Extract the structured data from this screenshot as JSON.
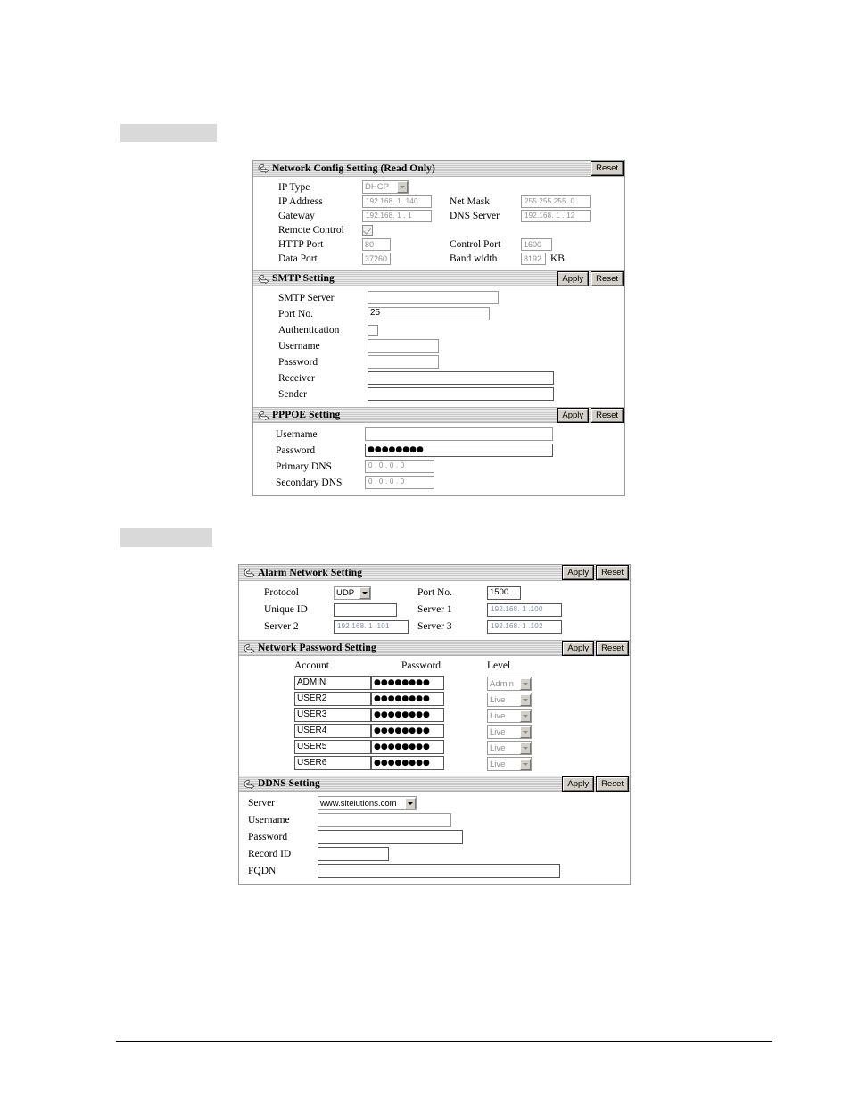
{
  "page": {
    "background": "#ffffff",
    "redacted_heading_1": "",
    "redacted_heading_2": ""
  },
  "common": {
    "apply_label": "Apply",
    "reset_label": "Reset",
    "arrow_icon": "circular-arrow-right-icon"
  },
  "network_config": {
    "title": "Network Config Setting (Read Only)",
    "reset_label": "Reset",
    "fields": {
      "ip_type_label": "IP Type",
      "ip_type_value": "DHCP",
      "ip_address_label": "IP Address",
      "ip_address_value": "192.168.  1 .140",
      "net_mask_label": "Net Mask",
      "net_mask_value": "255.255.255.  0",
      "gateway_label": "Gateway",
      "gateway_value": "192.168.  1 .  1",
      "dns_server_label": "DNS Server",
      "dns_server_value": "192.168.  1 . 12",
      "remote_control_label": "Remote Control",
      "remote_control_checked": true,
      "http_port_label": "HTTP Port",
      "http_port_value": "80",
      "control_port_label": "Control Port",
      "control_port_value": "1600",
      "data_port_label": "Data Port",
      "data_port_value": "37260",
      "band_width_label": "Band width",
      "band_width_value": "8192",
      "band_width_unit": "KB"
    }
  },
  "smtp": {
    "title": "SMTP Setting",
    "apply_label": "Apply",
    "reset_label": "Reset",
    "fields": {
      "server_label": "SMTP Server",
      "server_value": "",
      "port_label": "Port No.",
      "port_value": "25",
      "auth_label": "Authentication",
      "auth_checked": false,
      "username_label": "Username",
      "username_value": "",
      "password_label": "Password",
      "password_value": "",
      "receiver_label": "Receiver",
      "receiver_value": "",
      "sender_label": "Sender",
      "sender_value": ""
    }
  },
  "pppoe": {
    "title": "PPPOE Setting",
    "apply_label": "Apply",
    "reset_label": "Reset",
    "fields": {
      "username_label": "Username",
      "username_value": "",
      "password_label": "Password",
      "password_value": "●●●●●●●●",
      "primary_dns_label": "Primary DNS",
      "primary_dns_value": "0  .  0  .  0  .  0",
      "secondary_dns_label": "Secondary DNS",
      "secondary_dns_value": "0  .  0  .  0  .  0"
    }
  },
  "alarm_network": {
    "title": "Alarm Network Setting",
    "apply_label": "Apply",
    "reset_label": "Reset",
    "fields": {
      "protocol_label": "Protocol",
      "protocol_value": "UDP",
      "port_label": "Port No.",
      "port_value": "1500",
      "unique_id_label": "Unique ID",
      "unique_id_value": "",
      "server1_label": "Server 1",
      "server1_value": "192.168.  1 .100",
      "server2_label": "Server 2",
      "server2_value": "192.168.  1 .101",
      "server3_label": "Server 3",
      "server3_value": "192.168.  1 .102"
    }
  },
  "network_password": {
    "title": "Network Password Setting",
    "apply_label": "Apply",
    "reset_label": "Reset",
    "columns": [
      "Account",
      "Password",
      "Level"
    ],
    "rows": [
      {
        "account": "ADMIN",
        "password": "●●●●●●●●",
        "level": "Admin"
      },
      {
        "account": "USER2",
        "password": "●●●●●●●●",
        "level": "Live"
      },
      {
        "account": "USER3",
        "password": "●●●●●●●●",
        "level": "Live"
      },
      {
        "account": "USER4",
        "password": "●●●●●●●●",
        "level": "Live"
      },
      {
        "account": "USER5",
        "password": "●●●●●●●●",
        "level": "Live"
      },
      {
        "account": "USER6",
        "password": "●●●●●●●●",
        "level": "Live"
      }
    ]
  },
  "ddns": {
    "title": "DDNS Setting",
    "apply_label": "Apply",
    "reset_label": "Reset",
    "fields": {
      "server_label": "Server",
      "server_value": "www.sitelutions.com",
      "username_label": "Username",
      "username_value": "",
      "password_label": "Password",
      "password_value": "",
      "record_id_label": "Record ID",
      "record_id_value": "",
      "fqdn_label": "FQDN",
      "fqdn_value": ""
    }
  }
}
